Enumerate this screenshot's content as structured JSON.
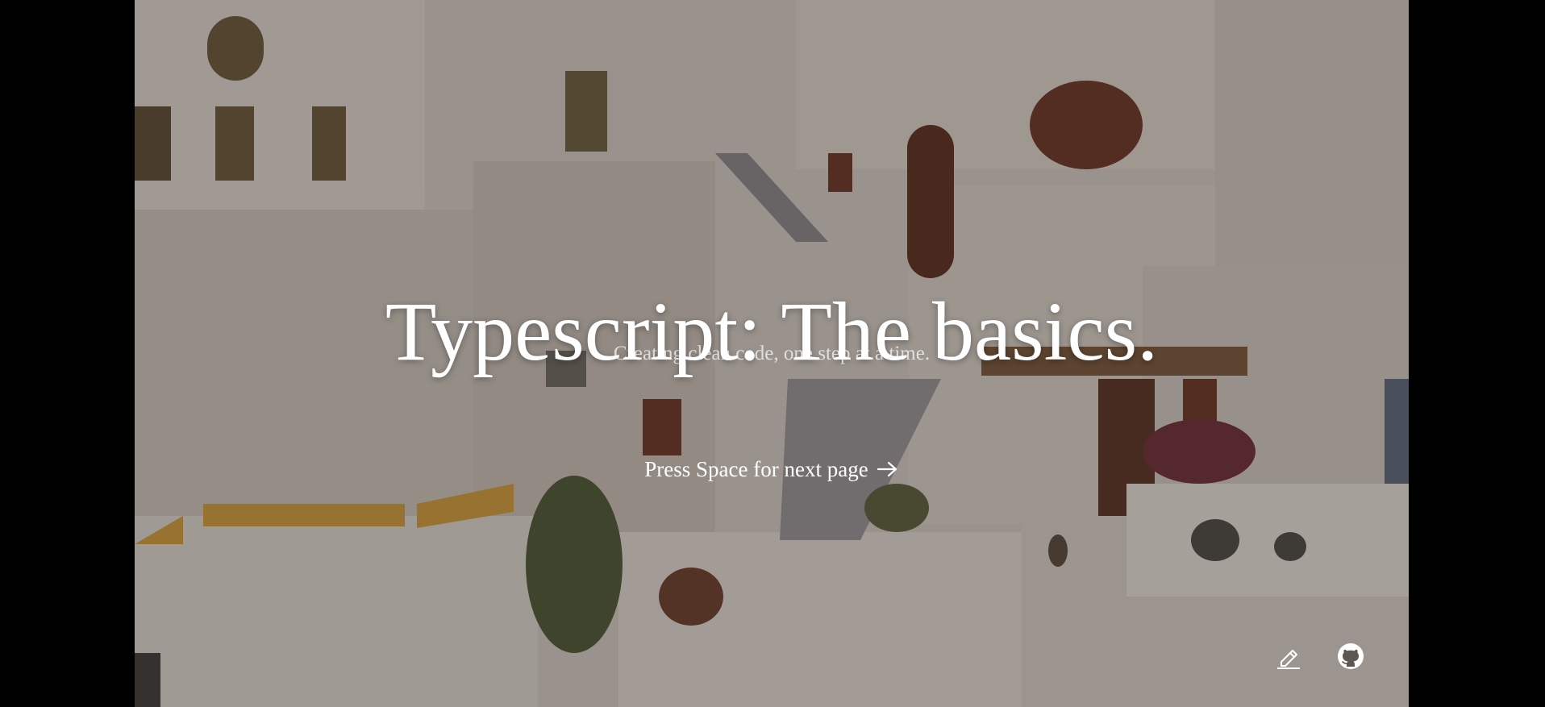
{
  "slide": {
    "title": "Typescript: The basics.",
    "subtitle": "Creating clean code, one step at a time.",
    "next_page_label": "Press Space for next page"
  },
  "icons": {
    "next_arrow": "arrow-right-icon",
    "edit": "pencil-icon",
    "github": "github-icon"
  },
  "colors": {
    "backdrop": "#000000",
    "text": "#ffffff",
    "overlay": "#261c16"
  }
}
